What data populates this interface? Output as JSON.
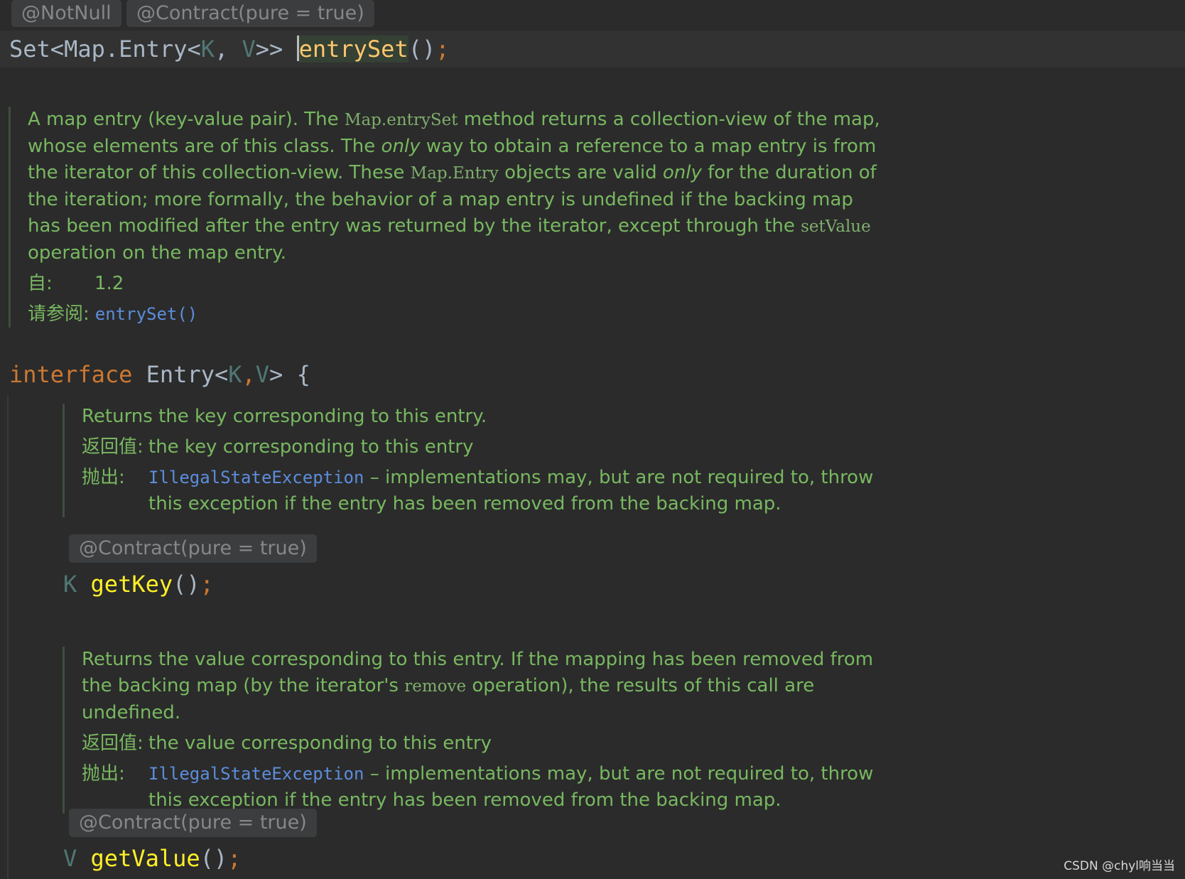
{
  "top_annotations": {
    "notnull": "@NotNull",
    "contract": "@Contract(pure = true)"
  },
  "entryset_line": {
    "return_type_a": "Set<Map.Entry<",
    "type_k": "K",
    "comma": ", ",
    "type_v": "V",
    "return_type_b": ">> ",
    "method": "entrySet",
    "parens": "()",
    "semi": ";"
  },
  "entry_doc": {
    "p1": "A map entry (key-value pair). The ",
    "code1": "Map.entrySet",
    "p2": " method returns a collection-view of the map, whose elements are of this class. The ",
    "em1": "only",
    "p3": " way to obtain a reference to a map entry is from the iterator of this collection-view. These ",
    "code2": "Map.Entry",
    "p4": " objects are valid ",
    "em2": "only",
    "p5": " for the duration of the iteration; more formally, the behavior of a map entry is undefined if the backing map has been modified after the entry was returned by the iterator, except through the ",
    "code3": "setValue",
    "p6": " operation on the map entry.",
    "since_label": "自:",
    "since_value": "1.2",
    "see_label": "请参阅:",
    "see_link": "entrySet()"
  },
  "interface_line": {
    "keyword": "interface",
    "name": " Entry<",
    "type_k": "K",
    "comma": ",",
    "type_v": "V",
    "close": "> {"
  },
  "getkey_doc": {
    "summary": "Returns the key corresponding to this entry.",
    "returns_label": "返回值:",
    "returns_text": "the key corresponding to this entry",
    "throws_label": "抛出:",
    "throws_link": "IllegalStateException",
    "throws_text": " – implementations may, but are not required to, throw this exception if the entry has been removed from the backing map."
  },
  "getkey_annotation": "@Contract(pure = true)",
  "getkey_line": {
    "type": "K",
    "method": "getKey",
    "parens": "()",
    "semi": ";"
  },
  "getvalue_doc": {
    "p1": "Returns the value corresponding to this entry. If the mapping has been removed from the backing map (by the iterator's ",
    "code1": "remove",
    "p2": " operation), the results of this call are undefined.",
    "returns_label": "返回值:",
    "returns_text": "the value corresponding to this entry",
    "throws_label": "抛出:",
    "throws_link": "IllegalStateException",
    "throws_text": " – implementations may, but are not required to, throw this exception if the entry has been removed from the backing map."
  },
  "getvalue_annotation": "@Contract(pure = true)",
  "getvalue_line": {
    "type": "V",
    "method": "getValue",
    "parens": "()",
    "semi": ";"
  },
  "watermark": "CSDN @chyl响当当",
  "colors": {
    "background": "#2b2b2b",
    "keyword": "#cc7832",
    "type_param": "#507874",
    "method": "#ffc66d",
    "doc_text": "#78b860",
    "link": "#5c8ddb",
    "inlay_bg": "#3b3d3f",
    "inlay_text": "#858789"
  }
}
